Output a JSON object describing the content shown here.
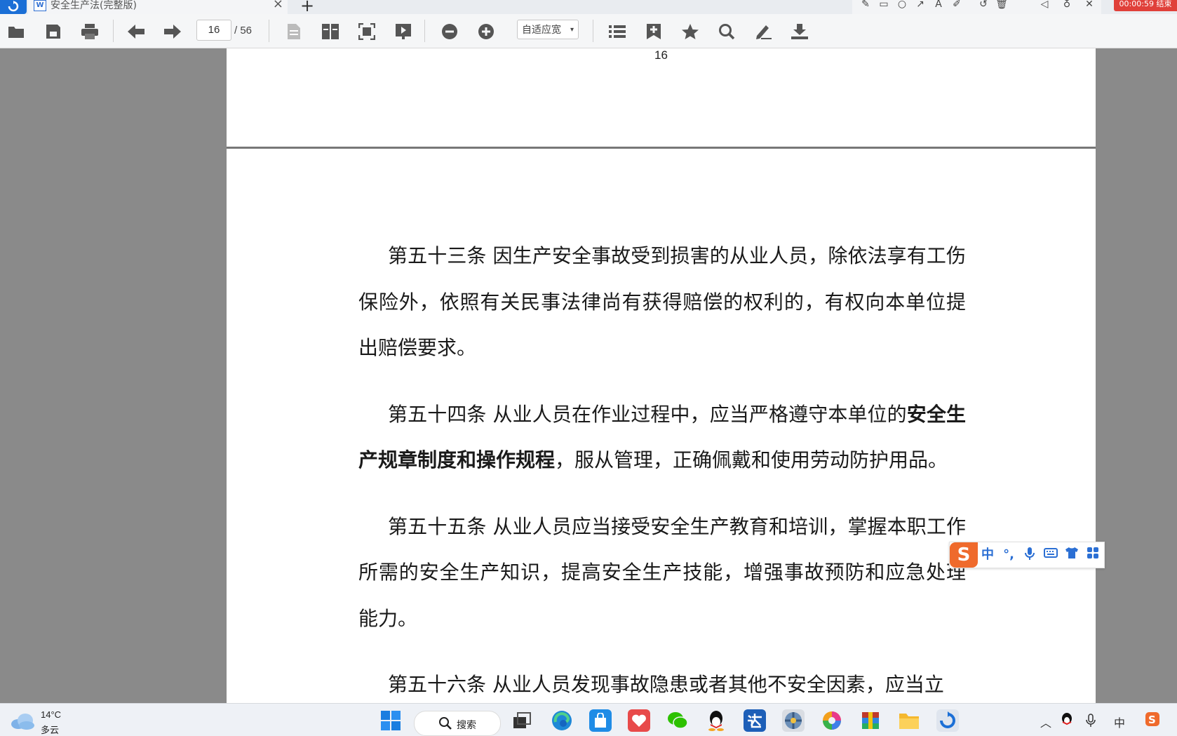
{
  "tabbar": {
    "doc_title": "安全生产法(完整版)",
    "doc_type_icon": "W",
    "close_glyph": "×",
    "new_tab_glyph": "+"
  },
  "recorder": {
    "timer": "00:00:59 结束",
    "tools": [
      "pen-icon",
      "rect-icon",
      "circle-icon",
      "arrow-icon",
      "text-icon",
      "highlighter-icon",
      "undo-icon",
      "trash-icon"
    ],
    "controls": [
      "speaker-icon",
      "mic-icon",
      "close-icon"
    ]
  },
  "toolbar": {
    "current_page": "16",
    "total_pages": "/ 56",
    "zoom_mode": "自适应宽",
    "zoom_caret": "▾"
  },
  "document": {
    "prev_page_number": "16",
    "paragraphs": [
      {
        "text": "第五十三条  因生产安全事故受到损害的从业人员，除依法享有工伤保险外，依照有关民事法律尚有获得赔偿的权利的，有权向本单位提出赔偿要求。"
      },
      {
        "before": "第五十四条  从业人员在作业过程中，应当严格遵守本单位的",
        "bold": "安全生产规章制度和操作规程",
        "after": "，服从管理，正确佩戴和使用劳动防护用品。"
      },
      {
        "text": "第五十五条  从业人员应当接受安全生产教育和培训，掌握本职工作所需的安全生产知识，提高安全生产技能，增强事故预防和应急处理能力。"
      },
      {
        "text": "第五十六条  从业人员发现事故隐患或者其他不安全因素，应当立"
      }
    ]
  },
  "ime": {
    "logo": "S",
    "mode": "中",
    "punct": "°,"
  },
  "taskbar": {
    "temperature": "14°C",
    "condition": "多云",
    "search_label": "搜索",
    "input_lang": "中"
  }
}
